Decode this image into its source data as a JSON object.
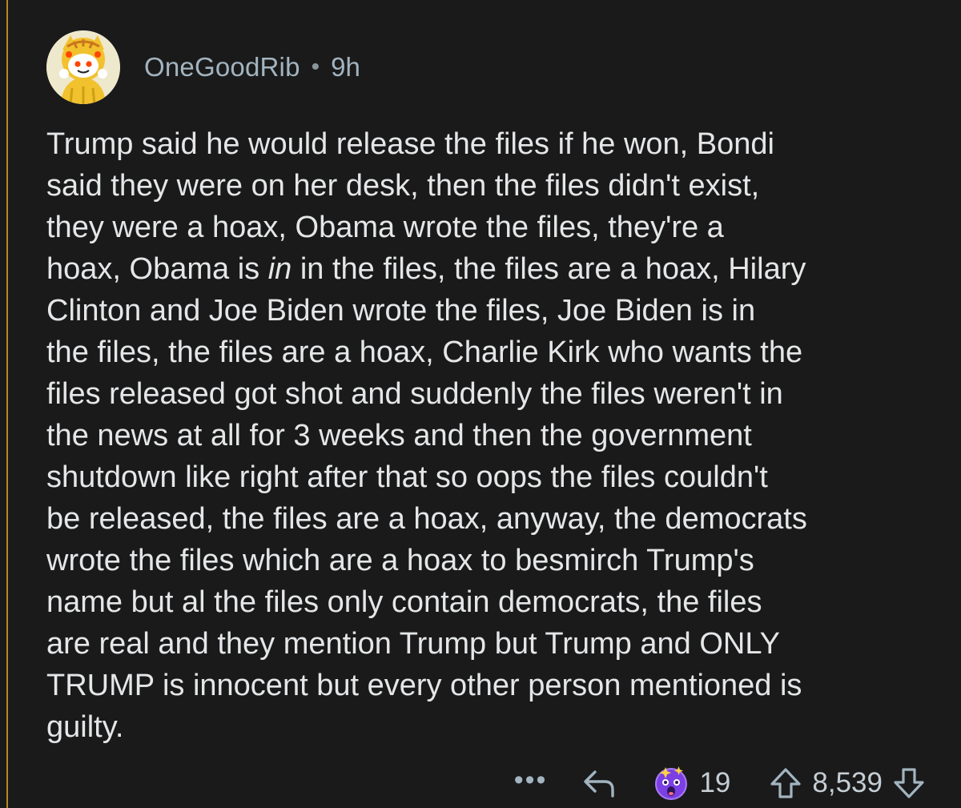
{
  "comment": {
    "username": "OneGoodRib",
    "separator": "•",
    "age": "9h",
    "avatar_icon": "snoo-avatar-icon",
    "body_lines": [
      {
        "text": "Trump said he would release the files if he won, Bondi"
      },
      {
        "text": "said they were on her desk, then the files didn't exist,"
      },
      {
        "text": "they were a hoax, Obama wrote the files, they're a"
      },
      {
        "pre": "hoax, Obama is ",
        "em": "in",
        "post": " in the files, the files are a hoax, Hilary"
      },
      {
        "text": "Clinton and Joe Biden wrote the files, Joe Biden is in"
      },
      {
        "text": "the files, the files are a hoax, Charlie Kirk who wants the"
      },
      {
        "text": "files released got shot and suddenly the files weren't in"
      },
      {
        "text": "the news at all for 3 weeks and then the government"
      },
      {
        "text": "shutdown like right after that so oops the files couldn't"
      },
      {
        "text": "be released, the files are a hoax, anyway, the democrats"
      },
      {
        "text": "wrote the files which are a hoax to besmirch Trump's"
      },
      {
        "text": "name but al the files only contain democrats, the files"
      },
      {
        "text": "are real and they mention Trump but Trump and ONLY"
      },
      {
        "text": "TRUMP is innocent but every other person mentioned is"
      },
      {
        "text": "guilty."
      }
    ]
  },
  "actions": {
    "more_label": "•••",
    "more_icon": "more-options-icon",
    "reply_icon": "reply-arrow-icon",
    "award_icon": "award-icon",
    "award_count": "19",
    "upvote_icon": "upvote-arrow-icon",
    "score": "8,539",
    "downvote_icon": "downvote-arrow-icon"
  },
  "colors": {
    "background": "#1a1a1b",
    "thread_line": "#b88a1e",
    "meta_text": "#a2b4bf",
    "body_text": "#e4e6e7"
  }
}
